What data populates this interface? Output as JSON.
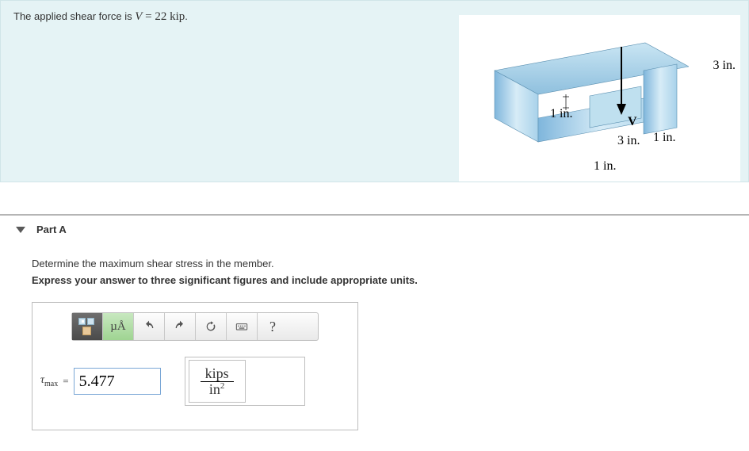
{
  "problem": {
    "prefix": "The applied shear force is ",
    "variable": "V",
    "equals": " = ",
    "value": "22 kip",
    "period": "."
  },
  "figure": {
    "dims": {
      "d1": "3 in.",
      "d2": "1 in.",
      "d3": "1 in.",
      "d4": "3 in.",
      "d5": "1 in.",
      "force": "V"
    }
  },
  "part": {
    "label": "Part A",
    "instruction": "Determine the maximum shear stress in the member.",
    "format_instruction": "Express your answer to three significant figures and include appropriate units."
  },
  "toolbar": {
    "templates_icon": "templates",
    "muA": "µÅ",
    "undo": "undo",
    "redo": "redo",
    "reset": "reset",
    "keyboard": "keyboard",
    "help": "?"
  },
  "answer": {
    "symbol": "τ",
    "subscript": "max",
    "equals": "=",
    "value": "5.477",
    "unit_numerator": "kips",
    "unit_denominator_base": "in",
    "unit_denominator_exp": "2"
  }
}
